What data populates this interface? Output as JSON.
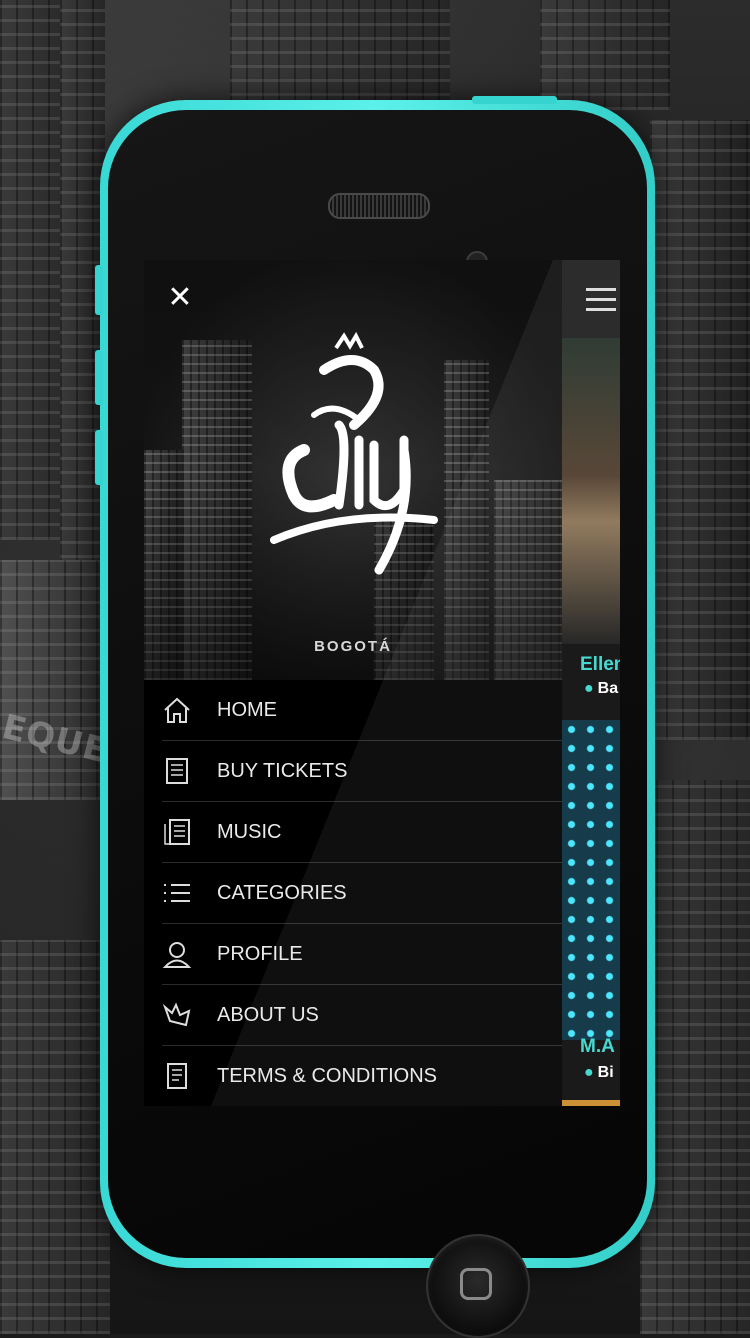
{
  "drawer": {
    "close_icon": "close-icon",
    "city": "BOGOTÁ",
    "menu": [
      {
        "label": "HOME",
        "icon": "home-icon"
      },
      {
        "label": "BUY TICKETS",
        "icon": "ticket-icon"
      },
      {
        "label": "MUSIC",
        "icon": "music-icon"
      },
      {
        "label": "CATEGORIES",
        "icon": "list-icon"
      },
      {
        "label": "PROFILE",
        "icon": "user-icon"
      },
      {
        "label": "ABOUT US",
        "icon": "about-icon"
      },
      {
        "label": "TERMS & CONDITIONS",
        "icon": "document-icon"
      }
    ]
  },
  "content": {
    "menu_icon": "hamburger-menu-icon",
    "cards": [
      {
        "title": "Ellen",
        "location": "Ba"
      },
      {
        "title": "M.A",
        "location": "Bi"
      }
    ]
  },
  "colors": {
    "accent": "#3bd7cf",
    "phone_body": "#4de6e0"
  }
}
